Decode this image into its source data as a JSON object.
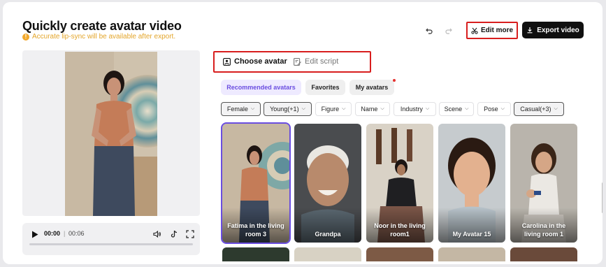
{
  "header": {
    "title": "Quickly create avatar video",
    "warning": "Accurate lip-sync will be available after export.",
    "edit_more_label": "Edit more",
    "export_label": "Export video"
  },
  "player": {
    "current_time": "00:00",
    "separator": "|",
    "total_time": "00:06",
    "progress": 0
  },
  "tabs": [
    {
      "label": "Choose avatar",
      "active": true
    },
    {
      "label": "Edit script",
      "active": false
    }
  ],
  "categories": [
    {
      "label": "Recommended avatars",
      "active": true
    },
    {
      "label": "Favorites",
      "active": false
    },
    {
      "label": "My avatars",
      "active": false,
      "notification": true
    }
  ],
  "filters": [
    {
      "label": "Female",
      "active": true
    },
    {
      "label": "Young(+1)",
      "active": true
    },
    {
      "label": "Figure",
      "active": false
    },
    {
      "label": "Name",
      "active": false
    },
    {
      "label": "Industry",
      "active": false
    },
    {
      "label": "Scene",
      "active": false
    },
    {
      "label": "Pose",
      "active": false
    },
    {
      "label": "Casual(+3)",
      "active": true
    }
  ],
  "avatars": [
    {
      "name": "Fatima in the living room 3",
      "selected": true
    },
    {
      "name": "Grandpa",
      "selected": false
    },
    {
      "name": "Noor in the living room1",
      "selected": false
    },
    {
      "name": "My Avatar 15",
      "selected": false
    },
    {
      "name": "Carolina in the living room 1",
      "selected": false
    }
  ],
  "colors": {
    "accent": "#6a4de0",
    "highlight_border": "#d81e1e",
    "warning": "#e3a52a",
    "primary_button": "#101010"
  }
}
